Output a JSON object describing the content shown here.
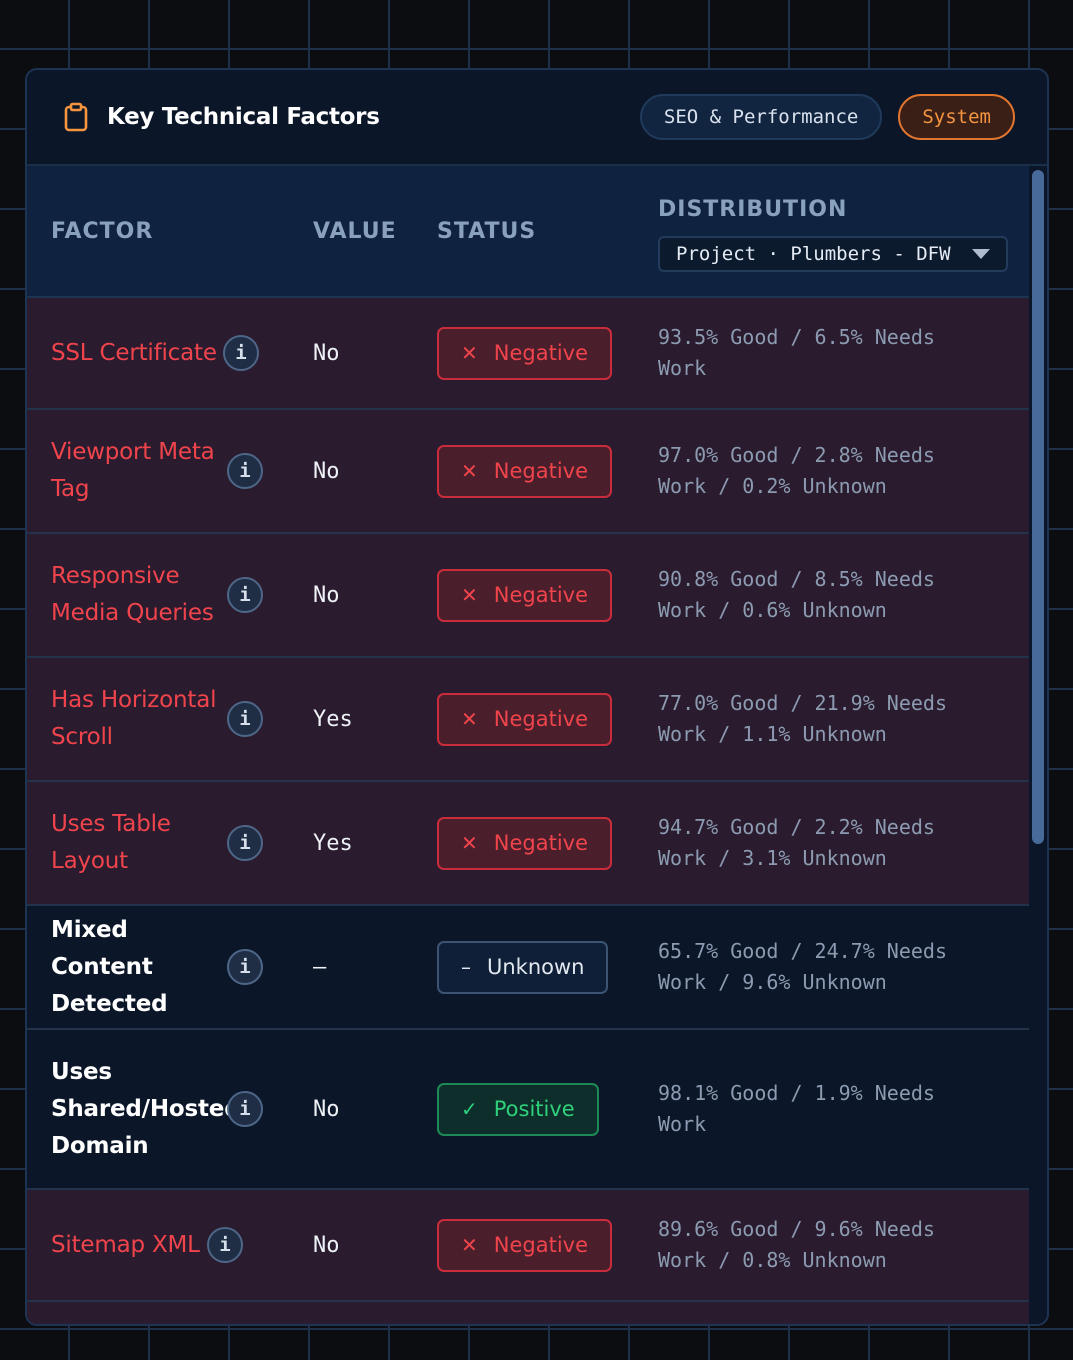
{
  "header": {
    "title": "Key Technical Factors",
    "icon": "clipboard-icon",
    "tabs": [
      {
        "label": "SEO & Performance",
        "active": false
      },
      {
        "label": "System",
        "active": true
      }
    ]
  },
  "table": {
    "columns": {
      "factor": "FACTOR",
      "value": "VALUE",
      "status": "STATUS",
      "distribution": "DISTRIBUTION"
    },
    "project_select": "Project · Plumbers - DFW",
    "rows": [
      {
        "factor": "SSL Certificate",
        "value": "No",
        "status": "Negative",
        "distribution": "93.5% Good / 6.5% Needs Work"
      },
      {
        "factor": "Viewport Meta Tag",
        "value": "No",
        "status": "Negative",
        "distribution": "97.0% Good / 2.8% Needs Work / 0.2% Unknown"
      },
      {
        "factor": "Responsive Media Queries",
        "value": "No",
        "status": "Negative",
        "distribution": "90.8% Good / 8.5% Needs Work / 0.6% Unknown"
      },
      {
        "factor": "Has Horizontal Scroll",
        "value": "Yes",
        "status": "Negative",
        "distribution": "77.0% Good / 21.9% Needs Work / 1.1% Unknown"
      },
      {
        "factor": "Uses Table Layout",
        "value": "Yes",
        "status": "Negative",
        "distribution": "94.7% Good / 2.2% Needs Work / 3.1% Unknown"
      },
      {
        "factor": "Mixed Content Detected",
        "value": "–",
        "status": "Unknown",
        "distribution": "65.7% Good / 24.7% Needs Work / 9.6% Unknown"
      },
      {
        "factor": "Uses Shared/Hosted Domain",
        "value": "No",
        "status": "Positive",
        "distribution": "98.1% Good / 1.9% Needs Work"
      },
      {
        "factor": "Sitemap XML",
        "value": "No",
        "status": "Negative",
        "distribution": "89.6% Good / 9.6% Needs Work / 0.8% Unknown"
      }
    ]
  },
  "colors": {
    "negative": "#f0444d",
    "positive": "#2fd07b",
    "accent": "#f5953f"
  }
}
